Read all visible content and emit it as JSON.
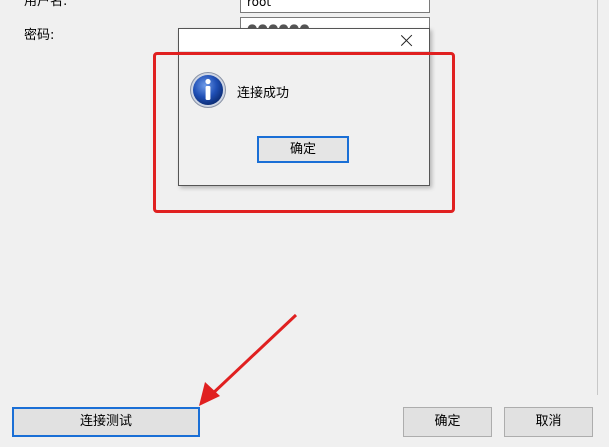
{
  "form": {
    "username_label": "用户名:",
    "username_value": "root",
    "password_label": "密码:",
    "password_value": "●●●●●●"
  },
  "dialog": {
    "message": "连接成功",
    "ok_label": "确定"
  },
  "footer": {
    "test_label": "连接测试",
    "ok_label": "确定",
    "cancel_label": "取消"
  },
  "annotation": {
    "color": "#e02020"
  },
  "accent": "#1a6fd6"
}
